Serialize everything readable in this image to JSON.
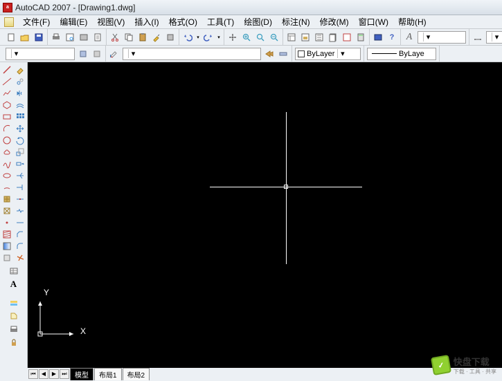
{
  "app": {
    "title": "AutoCAD 2007 - [Drawing1.dwg]",
    "icon_label": "a"
  },
  "menu": [
    "文件(F)",
    "编辑(E)",
    "视图(V)",
    "插入(I)",
    "格式(O)",
    "工具(T)",
    "绘图(D)",
    "标注(N)",
    "修改(M)",
    "窗口(W)",
    "帮助(H)"
  ],
  "layer": {
    "current": "ByLayer",
    "linetype": "ByLaye"
  },
  "font_marker": "A",
  "canvas": {
    "ucs_y": "Y",
    "ucs_x": "X"
  },
  "tabs": [
    "模型",
    "布局1",
    "布局2"
  ],
  "watermark": {
    "title": "快盘下载",
    "sub": "下载 · 工具 · 共享"
  }
}
